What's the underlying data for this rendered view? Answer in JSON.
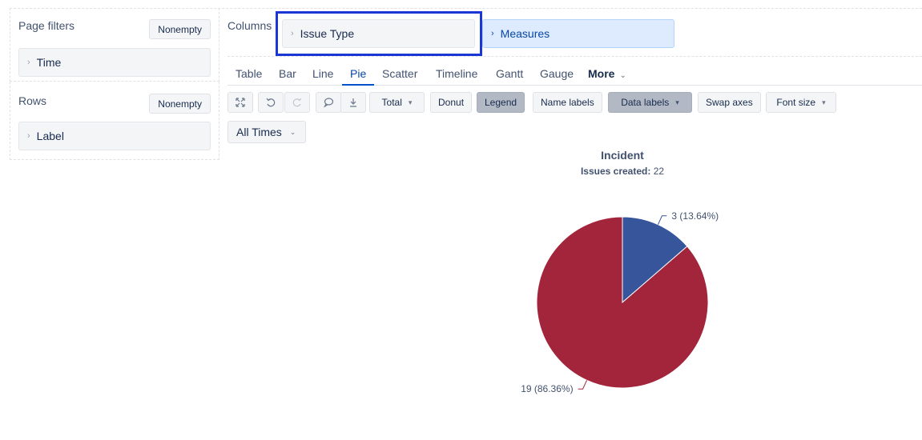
{
  "page_filters": {
    "title": "Page filters",
    "nonempty_label": "Nonempty",
    "dimension": "Time"
  },
  "rows": {
    "title": "Rows",
    "nonempty_label": "Nonempty",
    "dimension": "Label"
  },
  "columns": {
    "title": "Columns",
    "dimension": "Issue Type",
    "measures": "Measures"
  },
  "tabs": [
    "Table",
    "Bar",
    "Line",
    "Pie",
    "Scatter",
    "Timeline",
    "Gantt",
    "Gauge",
    "More"
  ],
  "active_tab": "Pie",
  "toolbar": {
    "total_label": "Total",
    "donut_label": "Donut",
    "legend_label": "Legend",
    "name_labels_label": "Name labels",
    "data_labels_label": "Data labels",
    "swap_axes_label": "Swap axes",
    "font_size_label": "Font size",
    "icons": [
      "fullscreen-icon",
      "undo-icon",
      "redo-icon",
      "comment-icon",
      "download-icon"
    ]
  },
  "time_selector": "All Times",
  "colors": {
    "series_a": "#36559b",
    "series_b": "#a3253b",
    "accent": "#0052cc",
    "highlight_border": "#1a36d4"
  },
  "chart_data": {
    "type": "pie",
    "title": "Incident",
    "subtitle_label": "Issues created:",
    "subtitle_value": "22",
    "slices": [
      {
        "value": 3,
        "label": "3 (13.64%)",
        "color": "#36559b"
      },
      {
        "value": 19,
        "label": "19 (86.36%)",
        "color": "#a3253b"
      }
    ],
    "total": 22
  }
}
